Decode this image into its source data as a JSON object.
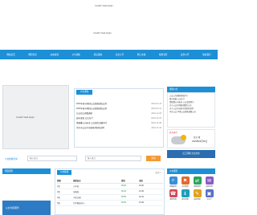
{
  "banner": {
    "plugin_msg_top": "Couldn't load plugin.",
    "plugin_msg_mid": "Couldn't load plugin."
  },
  "nav": {
    "items": [
      "网站首页",
      "网页浏览",
      "动态新闻",
      "公告通知",
      "招标采购",
      "信息公开",
      "网上办事",
      "规划专区",
      "政务公开",
      "联系我们"
    ]
  },
  "photo": {
    "plugin_msg": "Couldn't load plugin."
  },
  "news": {
    "tab": "公告通知",
    "rows": [
      {
        "title": "2023年春节期间公交线路调度安排",
        "date": "2023-01-18"
      },
      {
        "title": "2023年春节期间公交线路调度安排",
        "date": "2023-01-10"
      },
      {
        "title": "公交站点调整通知",
        "date": "2022-12-26"
      },
      {
        "title": "城市发展 公交先行",
        "date": "2022-12-15"
      },
      {
        "title": "情暖重心向未来 公交服务温暖同行",
        "date": "2022-12-08"
      },
      {
        "title": "关于市公交车前乘客须知的说明",
        "date": "2022-11-30"
      }
    ]
  },
  "side": {
    "head": "通知公告",
    "lines": [
      "公交公司通知新线开行",
      "城市发展 公交先行",
      "情暖重心向未来 公交温情同行",
      "关于公交车线路调整的公告",
      "关于公交车站乘车须知的说明",
      "本市公交 11路公交线路调整公告"
    ]
  },
  "weather": {
    "header": "北京天气",
    "city": "北京 晴",
    "temp": "2025年02月06日"
  },
  "promo": {
    "text": "员工风貌 企业文化"
  },
  "search": {
    "label": "公交线路查询",
    "from_placeholder": "输入起点",
    "to_placeholder": "输入终点",
    "button": "查询"
  },
  "left_panel": {
    "head": "便民服务",
    "img_text": "公交为民服务"
  },
  "table_panel": {
    "tab": "公交路线",
    "more": "更多>>",
    "headers": [
      "线路",
      "途经站点",
      "首班",
      "末班"
    ],
    "rows": [
      [
        "1路",
        "火车站",
        "06:00",
        "22:00"
      ],
      [
        "2路",
        "市政府",
        "06:10",
        "21:30"
      ],
      [
        "3路",
        "人民公园",
        "05:50",
        "22:10"
      ],
      [
        "5路",
        "汽车客运中心",
        "06:00",
        "21:00"
      ]
    ]
  },
  "right_panel": {
    "head": "公交服务",
    "icons": [
      {
        "label": "线路查询",
        "color": "#3b8fd9",
        "glyph": "⌕"
      },
      {
        "label": "站点查询",
        "color": "#e46a2c",
        "glyph": "⚑"
      },
      {
        "label": "换乘查询",
        "color": "#2aa35a",
        "glyph": "⇄"
      },
      {
        "label": "失物招领",
        "color": "#8a5cc2",
        "glyph": "✉"
      },
      {
        "label": "服务热线",
        "color": "#d14b5a",
        "glyph": "☎"
      },
      {
        "label": "乘车须知",
        "color": "#1f9fb8",
        "glyph": "ℹ"
      },
      {
        "label": "投诉建议",
        "color": "#e0a21f",
        "glyph": "✎"
      },
      {
        "label": "公交卡",
        "color": "#5670c9",
        "glyph": "▣"
      }
    ]
  }
}
